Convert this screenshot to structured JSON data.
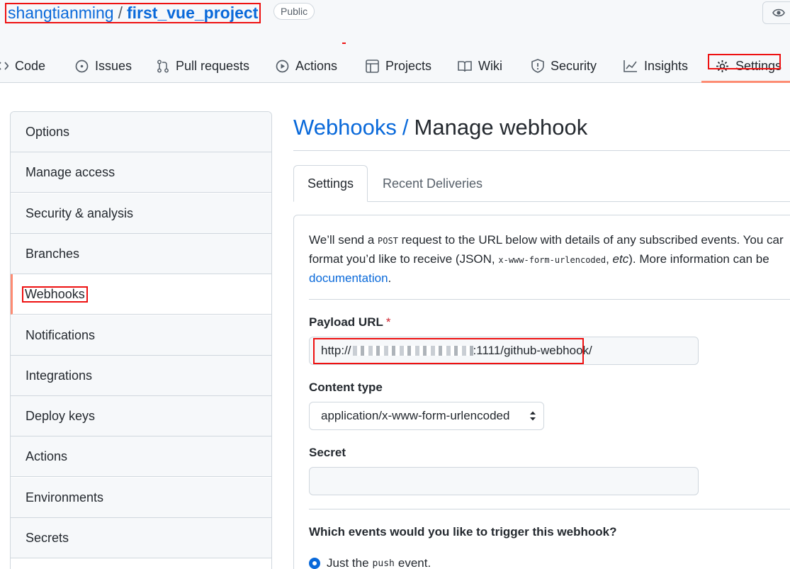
{
  "repo": {
    "owner": "shangtianming",
    "separator": "/",
    "name": "first_vue_project",
    "visibility": "Public"
  },
  "nav": {
    "tabs": [
      {
        "label": "Code",
        "icon": "code-icon"
      },
      {
        "label": "Issues",
        "icon": "issue-opened-icon"
      },
      {
        "label": "Pull requests",
        "icon": "git-pull-request-icon"
      },
      {
        "label": "Actions",
        "icon": "play-icon"
      },
      {
        "label": "Projects",
        "icon": "table-icon"
      },
      {
        "label": "Wiki",
        "icon": "book-icon"
      },
      {
        "label": "Security",
        "icon": "shield-icon"
      },
      {
        "label": "Insights",
        "icon": "graph-icon"
      },
      {
        "label": "Settings",
        "icon": "gear-icon",
        "selected": true
      }
    ]
  },
  "sidebar": {
    "items": [
      {
        "label": "Options"
      },
      {
        "label": "Manage access"
      },
      {
        "label": "Security & analysis"
      },
      {
        "label": "Branches"
      },
      {
        "label": "Webhooks",
        "active": true
      },
      {
        "label": "Notifications"
      },
      {
        "label": "Integrations"
      },
      {
        "label": "Deploy keys"
      },
      {
        "label": "Actions"
      },
      {
        "label": "Environments"
      },
      {
        "label": "Secrets"
      }
    ]
  },
  "main": {
    "breadcrumb": "Webhooks",
    "breadcrumb_sep": "/",
    "title": "Manage webhook",
    "subtabs": [
      {
        "label": "Settings",
        "active": true
      },
      {
        "label": "Recent Deliveries"
      }
    ],
    "intro": {
      "part1": "We’ll send a ",
      "code1": "POST",
      "part2": " request to the URL below with details of any subscribed events. You car",
      "part3": "format you’d like to receive (JSON, ",
      "code2": "x-www-form-urlencoded",
      "part4": ", ",
      "italic": "etc",
      "part5": "). More information can be",
      "link": "documentation",
      "part6": "."
    },
    "payload_url_label": "Payload URL",
    "required_mark": "*",
    "payload_url_prefix": "http://",
    "payload_url_suffix": ":1111/github-webhook/",
    "content_type_label": "Content type",
    "content_type_value": "application/x-www-form-urlencoded",
    "secret_label": "Secret",
    "secret_value": "",
    "events_question": "Which events would you like to trigger this webhook?",
    "radio_label_pre": "Just the",
    "radio_code": "push",
    "radio_label_post": "event."
  },
  "colors": {
    "accent": "#0969da",
    "annotation_red": "#ee1111",
    "selected_underline": "#fd8c73"
  }
}
